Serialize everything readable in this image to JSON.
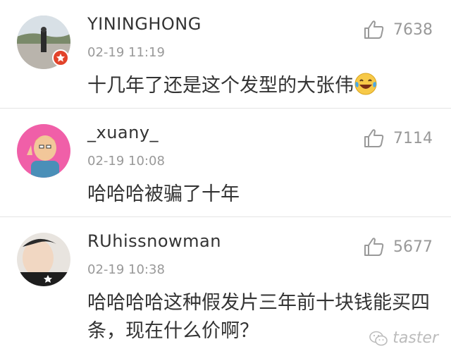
{
  "comments": [
    {
      "username": "YININGHONG",
      "time": "02-19 11:19",
      "likes": "7638",
      "text": "十几年了还是这个发型的大张伟",
      "emoji": "laughing-tears-emoji"
    },
    {
      "username": "_xuany_",
      "time": "02-19 10:08",
      "likes": "7114",
      "text": "哈哈哈被骗了十年"
    },
    {
      "username": "RUhissnowman",
      "time": "02-19 10:38",
      "likes": "5677",
      "text": "哈哈哈哈这种假发片三年前十块钱能买四条，现在什么价啊？"
    }
  ],
  "watermark": {
    "label": "taster",
    "icon": "wechat-icon"
  }
}
